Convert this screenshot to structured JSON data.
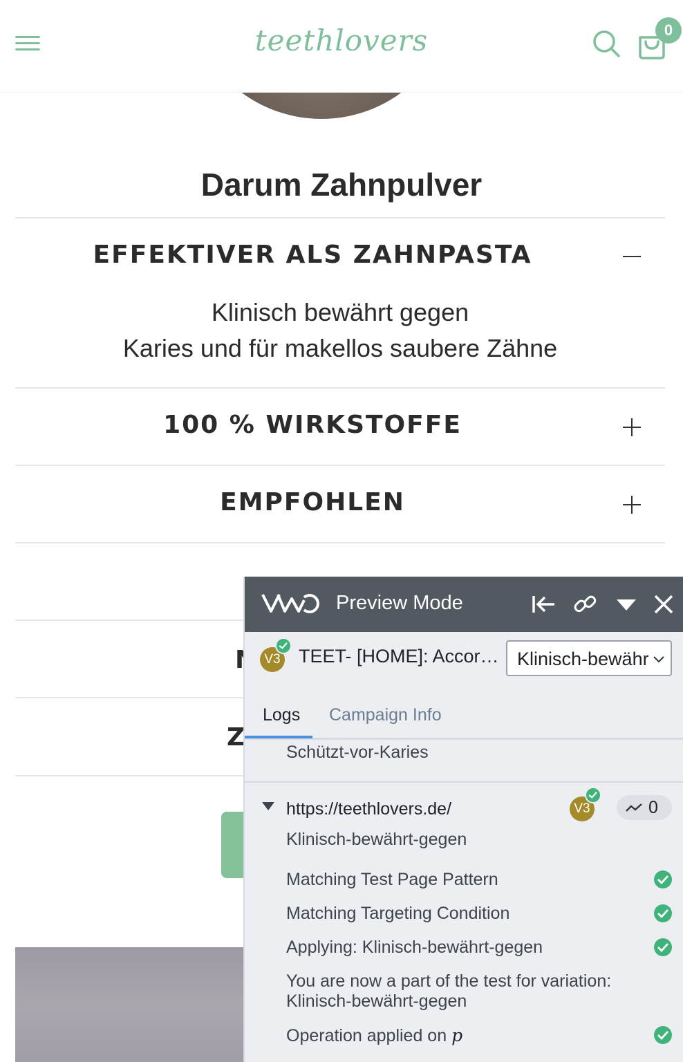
{
  "header": {
    "logo_text": "teethlovers",
    "cart_count": "0"
  },
  "section": {
    "heading": "Darum Zahnpulver"
  },
  "accordion": {
    "items": [
      {
        "title": "EFFEKTIVER ALS ZAHNPASTA",
        "expanded": true,
        "body_line_1": "Klinisch bewährt gegen",
        "body_line_2": "Karies und für makellos saubere Zähne"
      },
      {
        "title": "100 % WIRKSTOFFE",
        "expanded": false
      },
      {
        "title": "EMPFOHLEN",
        "expanded": false
      }
    ],
    "partial_letters": [
      "N",
      "Z"
    ]
  },
  "vwo": {
    "title": "Preview Mode",
    "variation_badge": "V3",
    "campaign_name": "TEET- [HOME]: Accord…",
    "selected_variation": "Klinisch-bewähr",
    "tabs": [
      "Logs",
      "Campaign Info"
    ],
    "logs": {
      "previous_entry": "Schützt-vor-Karies",
      "url": "https://teethlovers.de/",
      "url_variation": "Klinisch-bewährt-gegen",
      "count": "0",
      "entries": [
        "Matching Test Page Pattern",
        "Matching Targeting Condition",
        "Applying: Klinisch-bewährt-gegen"
      ],
      "join_message_line_1": "You are now a part of the test for variation:",
      "join_message_line_2": "Klinisch-bewährt-gegen",
      "operation_prefix": "Operation applied on ",
      "operation_target": "p"
    }
  },
  "colors": {
    "brand_green": "#7fbf9c",
    "vwo_bar": "#535961",
    "vwo_panel": "#eceef1",
    "check_green": "#3fb37a",
    "badge_gold": "#a58a2a",
    "tab_underline": "#4a90e2"
  },
  "icons": {
    "menu": "hamburger-icon",
    "search": "search-icon",
    "cart": "cart-icon",
    "collapse_panel": "collapse-left-icon",
    "link": "link-icon",
    "minimize": "caret-down-icon",
    "close": "close-icon",
    "check": "check-circle-icon",
    "trend": "trend-icon"
  }
}
